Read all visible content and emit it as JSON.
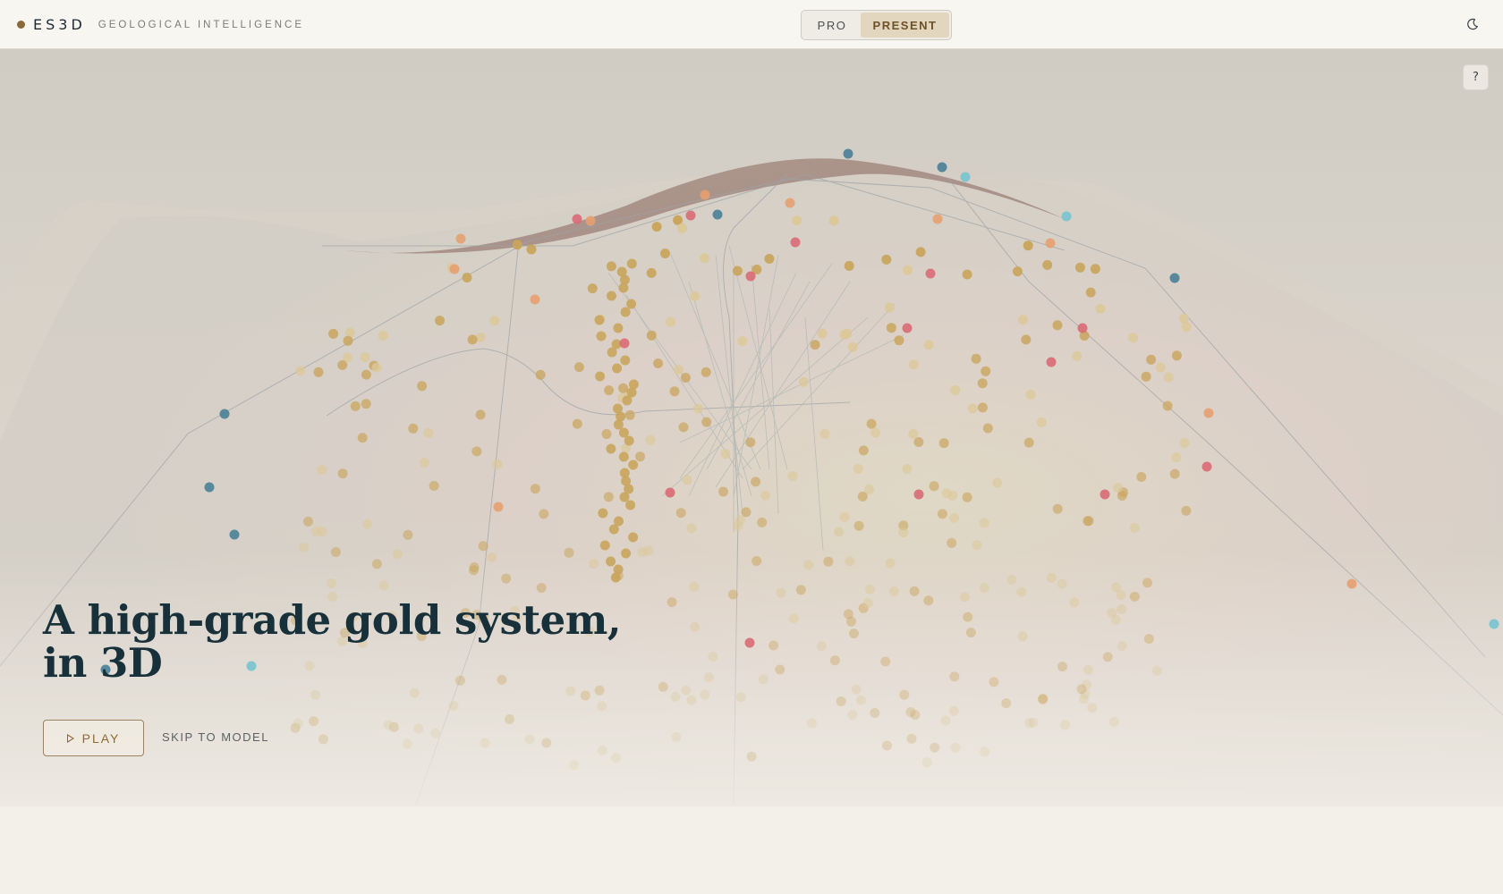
{
  "brand": {
    "name": "ES3D",
    "tagline": "GEOLOGICAL INTELLIGENCE",
    "accent": "#8a6a3a"
  },
  "mode_toggle": {
    "options": [
      "PRO",
      "PRESENT"
    ],
    "selected": "PRESENT"
  },
  "theme_toggle": {
    "icon": "moon-icon"
  },
  "scene": {
    "help_label": "?",
    "marker_colors": {
      "gold": "#c9a45c",
      "sand": "#dcc898",
      "orange": "#e7a070",
      "red": "#d96a74",
      "teal": "#4a7f96",
      "cyan": "#77c3cf"
    }
  },
  "hero": {
    "title_line1": "A high-grade gold system,",
    "title_line2": "in 3D",
    "play_label": "PLAY",
    "skip_label": "SKIP TO MODEL"
  }
}
